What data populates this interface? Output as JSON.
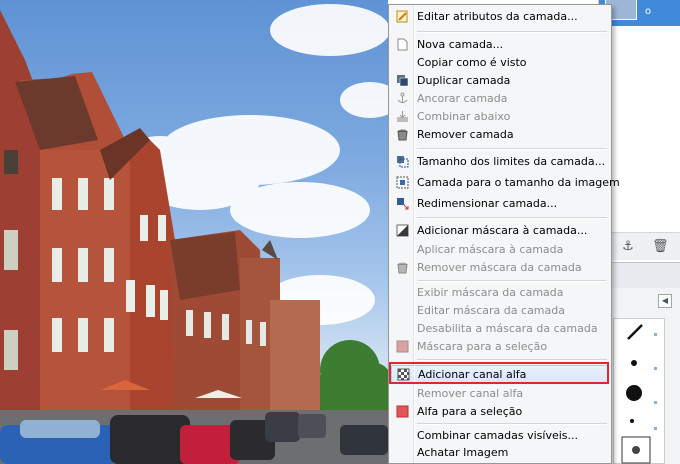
{
  "layers_panel": {
    "active_layer_name": "o",
    "anchor_icon": "anchor-icon",
    "delete_icon": "trash-icon"
  },
  "brushes_panel": {
    "menu_button": "◀"
  },
  "context_menu": {
    "items": [
      {
        "label": "Editar atributos da camada...",
        "icon": "edit-attributes-icon",
        "enabled": true
      },
      {
        "label": "Nova camada...",
        "icon": "new-layer-icon",
        "enabled": true
      },
      {
        "label": "Copiar como é visto",
        "icon": "",
        "enabled": true
      },
      {
        "label": "Duplicar camada",
        "icon": "duplicate-layer-icon",
        "enabled": true
      },
      {
        "label": "Ancorar camada",
        "icon": "anchor-icon",
        "enabled": false
      },
      {
        "label": "Combinar abaixo",
        "icon": "merge-down-icon",
        "enabled": false
      },
      {
        "label": "Remover camada",
        "icon": "trash-icon",
        "enabled": true
      },
      {
        "label": "Tamanho dos limites da camada...",
        "icon": "layer-boundary-icon",
        "enabled": true
      },
      {
        "label": "Camada para o tamanho da imagem",
        "icon": "layer-to-image-size-icon",
        "enabled": true
      },
      {
        "label": "Redimensionar camada...",
        "icon": "scale-layer-icon",
        "enabled": true
      },
      {
        "label": "Adicionar máscara à camada...",
        "icon": "add-mask-icon",
        "enabled": true
      },
      {
        "label": "Aplicar máscara à camada",
        "icon": "",
        "enabled": false
      },
      {
        "label": "Remover máscara da camada",
        "icon": "trash-icon",
        "enabled": false
      },
      {
        "label": "Exibir máscara da camada",
        "icon": "",
        "enabled": false
      },
      {
        "label": "Editar máscara da camada",
        "icon": "",
        "enabled": false
      },
      {
        "label": "Desabilita a máscara da camada",
        "icon": "",
        "enabled": false
      },
      {
        "label": "Máscara para a seleção",
        "icon": "mask-to-selection-icon",
        "enabled": false
      },
      {
        "label": "Adicionar canal alfa",
        "icon": "alpha-channel-icon",
        "enabled": true,
        "highlighted": true
      },
      {
        "label": "Remover canal alfa",
        "icon": "",
        "enabled": false
      },
      {
        "label": "Alfa para a seleção",
        "icon": "alpha-to-selection-icon",
        "enabled": true
      },
      {
        "label": "Combinar camadas visíveis...",
        "icon": "",
        "enabled": true
      },
      {
        "label": "Achatar Imagem",
        "icon": "",
        "enabled": true
      }
    ]
  },
  "colors": {
    "highlight_border": "#e1272d",
    "selection_blue": "#3f8ad9",
    "brick_red": "#a8432f"
  }
}
